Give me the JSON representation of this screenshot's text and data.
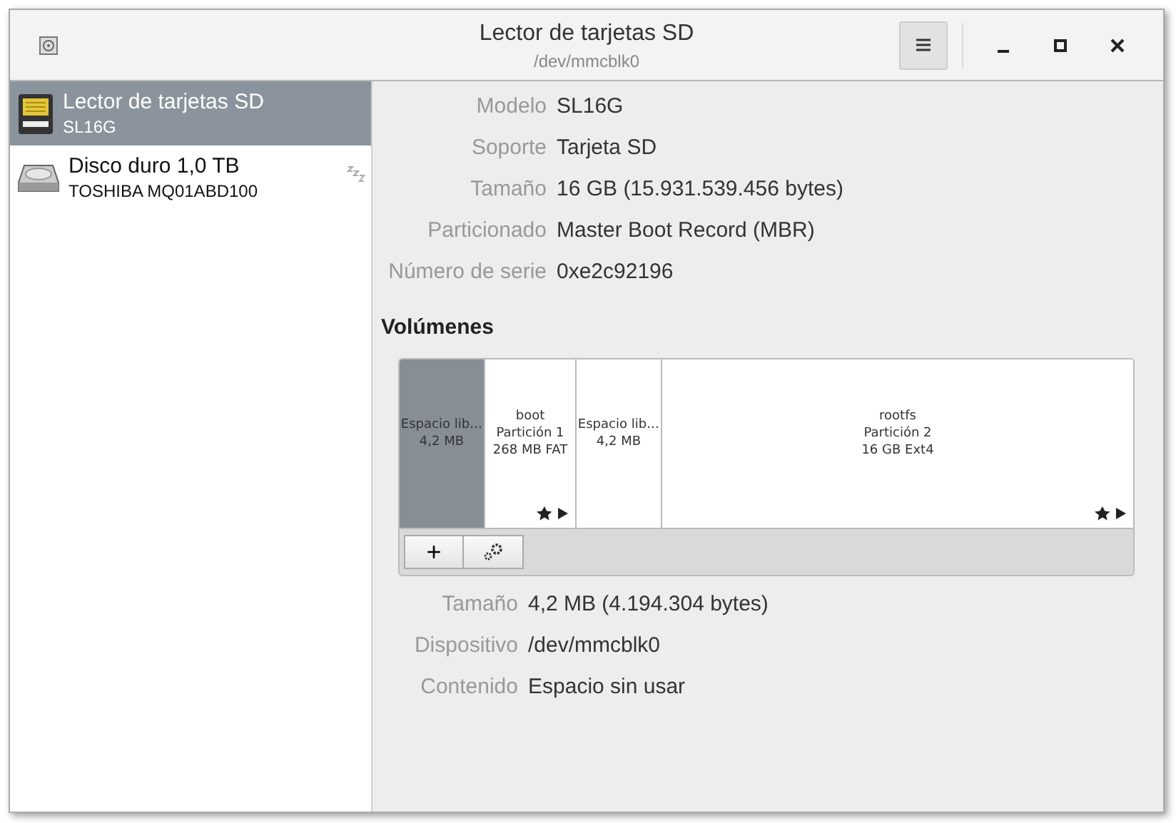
{
  "window": {
    "title": "Lector de tarjetas SD",
    "subtitle": "/dev/mmcblk0"
  },
  "sidebar": {
    "items": [
      {
        "name": "Lector de tarjetas SD",
        "detail": "SL16G",
        "kind": "card",
        "selected": true,
        "sleeping": false
      },
      {
        "name": "Disco duro 1,0 TB",
        "detail": "TOSHIBA MQ01ABD100",
        "kind": "disk",
        "selected": false,
        "sleeping": true
      }
    ]
  },
  "drive": [
    {
      "label": "Modelo",
      "value": "SL16G"
    },
    {
      "label": "Soporte",
      "value": "Tarjeta SD"
    },
    {
      "label": "Tamaño",
      "value": "16 GB (15.931.539.456 bytes)"
    },
    {
      "label": "Particionado",
      "value": "Master Boot Record (MBR)"
    },
    {
      "label": "Número de serie",
      "value": "0xe2c92196"
    }
  ],
  "volumes": {
    "heading": "Volúmenes",
    "partitions": [
      {
        "kind": "free",
        "lines": [
          "Espacio lib…",
          "4,2 MB"
        ],
        "selected": true
      },
      {
        "kind": "partition",
        "lines": [
          "boot",
          "Partición 1",
          "268 MB FAT"
        ],
        "selected": false
      },
      {
        "kind": "free",
        "lines": [
          "Espacio lib…",
          "4,2 MB"
        ],
        "selected": false
      },
      {
        "kind": "partition",
        "lines": [
          "rootfs",
          "Partición 2",
          "16 GB Ext4"
        ],
        "selected": false
      }
    ],
    "toolbar": [
      {
        "kind": "add",
        "label": "+"
      },
      {
        "kind": "settings"
      }
    ]
  },
  "volume_info": [
    {
      "label": "Tamaño",
      "value": "4,2 MB (4.194.304 bytes)"
    },
    {
      "label": "Dispositivo",
      "value": "/dev/mmcblk0"
    },
    {
      "label": "Contenido",
      "value": "Espacio sin usar"
    }
  ]
}
